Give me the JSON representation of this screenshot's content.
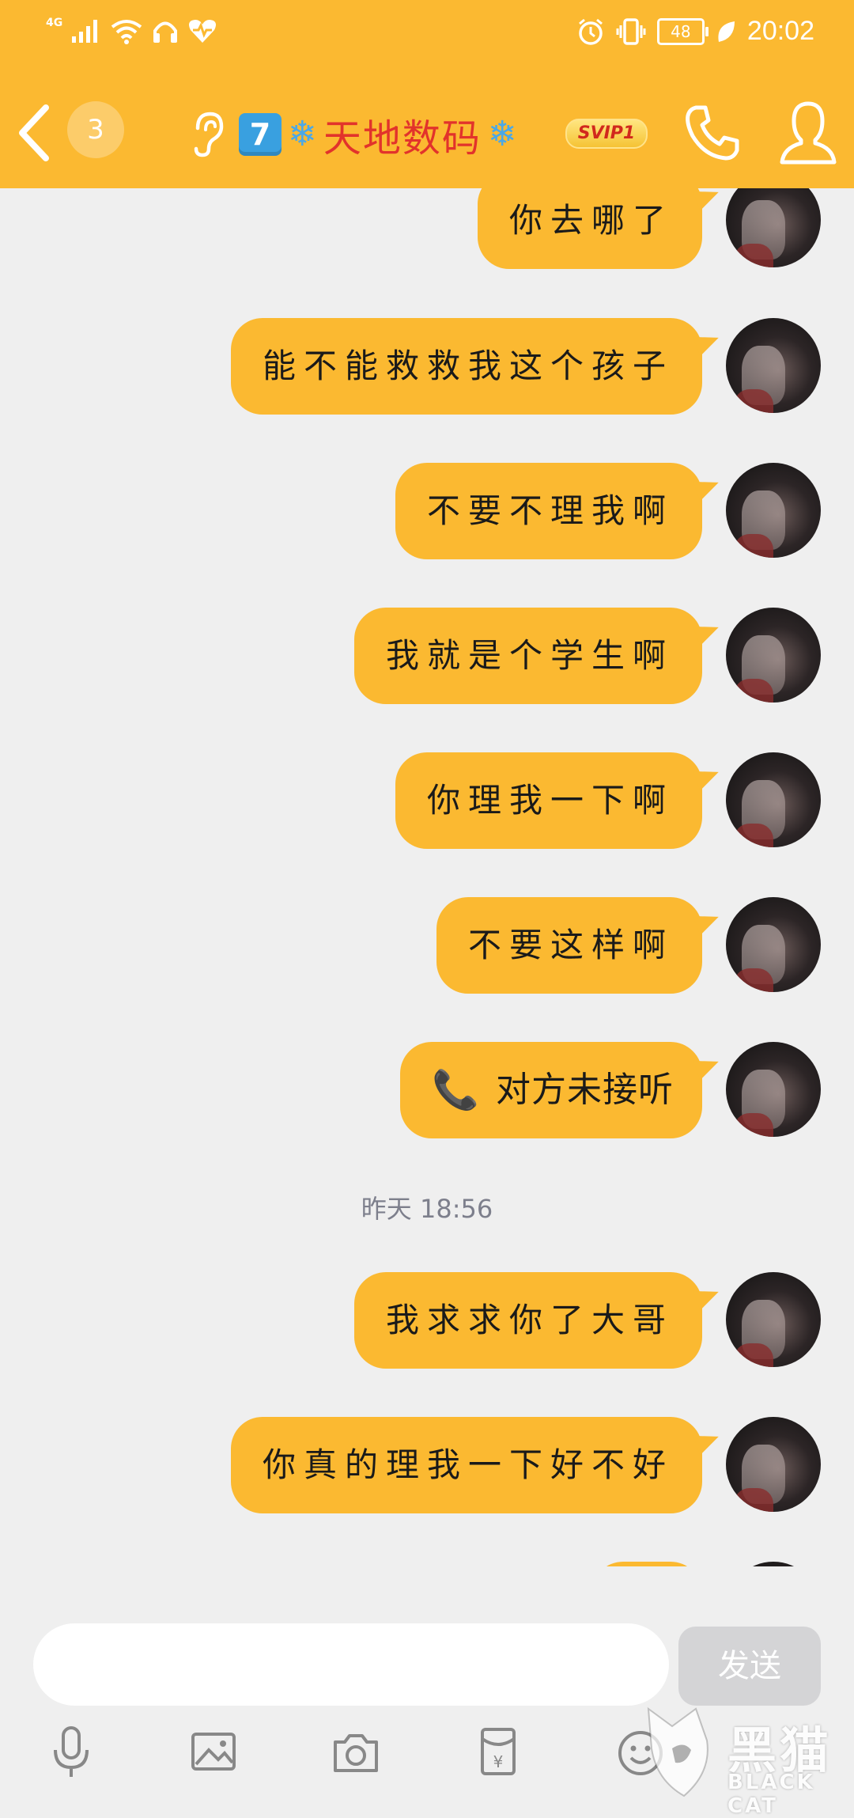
{
  "status_bar": {
    "network": "4G",
    "battery": "48",
    "time": "20:02"
  },
  "header": {
    "unread_count": "3",
    "title_keycap": "7",
    "title_text": "天地数码",
    "vip_badge": "SVIP1",
    "background_color": "#fbb931",
    "title_color": "#e2332b"
  },
  "messages": [
    {
      "text": "你去哪了"
    },
    {
      "text": "能不能救救我这个孩子"
    },
    {
      "text": "不要不理我啊"
    },
    {
      "text": "我就是个学生啊"
    },
    {
      "text": "你理我一下啊"
    },
    {
      "text": "不要这样啊"
    },
    {
      "text": "对方未接听",
      "type": "call"
    },
    {
      "text": "我求求你了大哥"
    },
    {
      "text": "你真的理我一下好不好"
    }
  ],
  "timestamp": "昨天 18:56",
  "composer": {
    "send_label": "发送",
    "input_value": ""
  },
  "watermark": {
    "text": "黑猫",
    "sub": "BLACK CAT"
  },
  "icons": [
    "back-icon",
    "ear-icon",
    "phone-icon",
    "profile-icon",
    "mic-icon",
    "image-icon",
    "camera-icon",
    "red-packet-icon",
    "emoji-icon"
  ]
}
